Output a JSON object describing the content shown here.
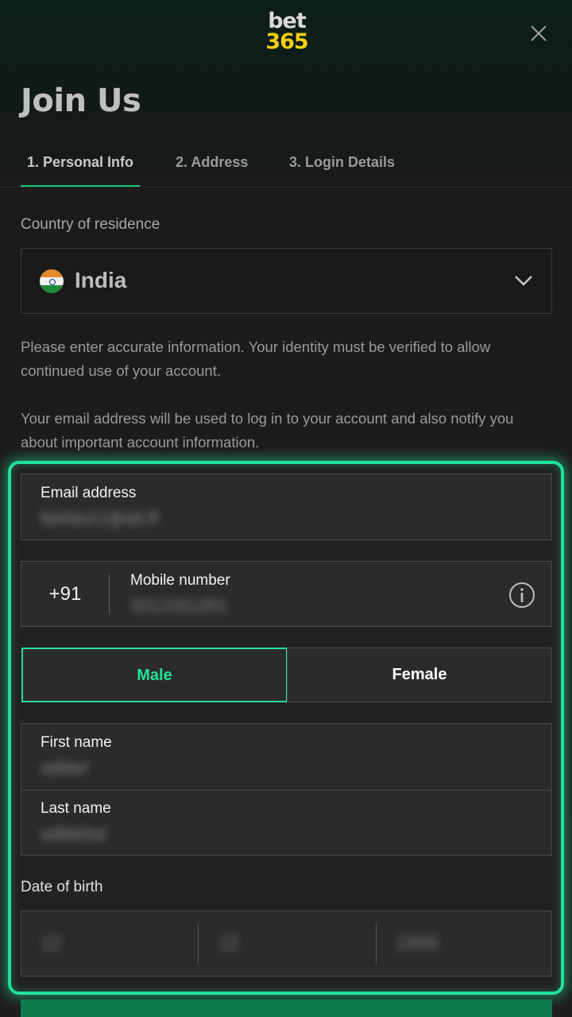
{
  "header": {
    "logo_line1": "bet",
    "logo_line2": "365",
    "title": "Join Us"
  },
  "tabs": [
    {
      "label": "1.  Personal Info",
      "active": true
    },
    {
      "label": "2.  Address",
      "active": false
    },
    {
      "label": "3.  Login Details",
      "active": false
    }
  ],
  "country": {
    "label": "Country of residence",
    "value": "India",
    "flag_icon": "india-flag-icon"
  },
  "info": {
    "identity": "Please enter accurate information. Your identity must be verified to allow continued use of your account.",
    "email_notice": "Your email address will be used to log in to your account and also notify you about important account information."
  },
  "form": {
    "email_label": "Email address",
    "email_value": "fdsfds21@dd.ff",
    "phone_prefix": "+91",
    "mobile_label": "Mobile number",
    "mobile_value": "3212151251",
    "gender_male": "Male",
    "gender_female": "Female",
    "gender_selected": "Male",
    "first_name_label": "First name",
    "first_name_value": "sdfdsf",
    "last_name_label": "Last name",
    "last_name_value": "sdfdsfsd",
    "dob_label": "Date of birth",
    "dob_day": "12",
    "dob_month": "12",
    "dob_year": "1999"
  },
  "colors": {
    "accent": "#22e09a",
    "logo_yellow": "#f2d10f",
    "cta_green": "#0f7a4d"
  }
}
